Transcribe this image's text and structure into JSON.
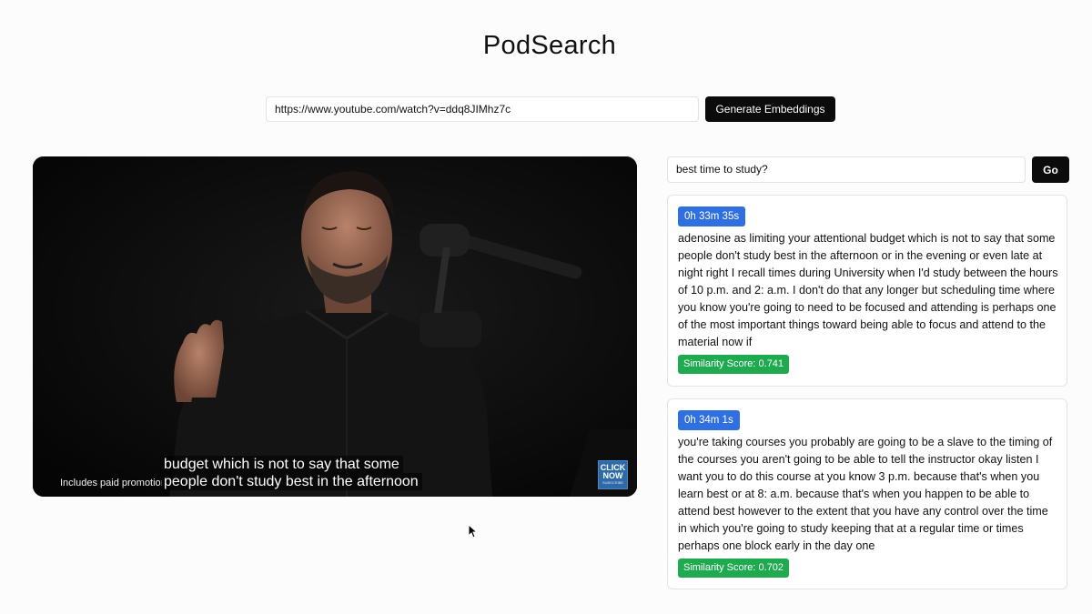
{
  "app": {
    "title": "PodSearch"
  },
  "embed": {
    "url_value": "https://www.youtube.com/watch?v=ddq8JIMhz7c",
    "button_label": "Generate Embeddings"
  },
  "video": {
    "promo_text": "Includes paid promotion",
    "caption_line1": "budget which is not to say that some",
    "caption_line2": "people don't study best in the afternoon",
    "click_now_label1": "CLICK",
    "click_now_label2": "NOW",
    "click_now_sub": "SUBSCRIBE"
  },
  "search": {
    "query_value": "best time to study?",
    "go_label": "Go"
  },
  "results": [
    {
      "timestamp": "0h 33m 35s",
      "text": "adenosine as limiting your attentional budget which is not to say that some people don't study best in the afternoon or in the evening or even late at night right I recall times during University when I'd study between the hours of 10 p.m. and 2: a.m. I don't do that any longer but scheduling time where you know you're going to need to be focused and attending is perhaps one of the most important things toward being able to focus and attend to the material now if",
      "score": "Similarity Score: 0.741"
    },
    {
      "timestamp": "0h 34m 1s",
      "text": "you're taking courses you probably are going to be a slave to the timing of the courses you aren't going to be able to tell the instructor okay listen I want you to do this course at you know 3 p.m. because that's when you learn best or at 8: a.m. because that's when you happen to be able to attend best however to the extent that you have any control over the time in which you're going to study keeping that at a regular time or times perhaps one block early in the day one",
      "score": "Similarity Score: 0.702"
    }
  ],
  "colors": {
    "timestamp_badge": "#2f6fe0",
    "score_badge": "#1faa4f",
    "button_bg": "#0b0b0b"
  }
}
